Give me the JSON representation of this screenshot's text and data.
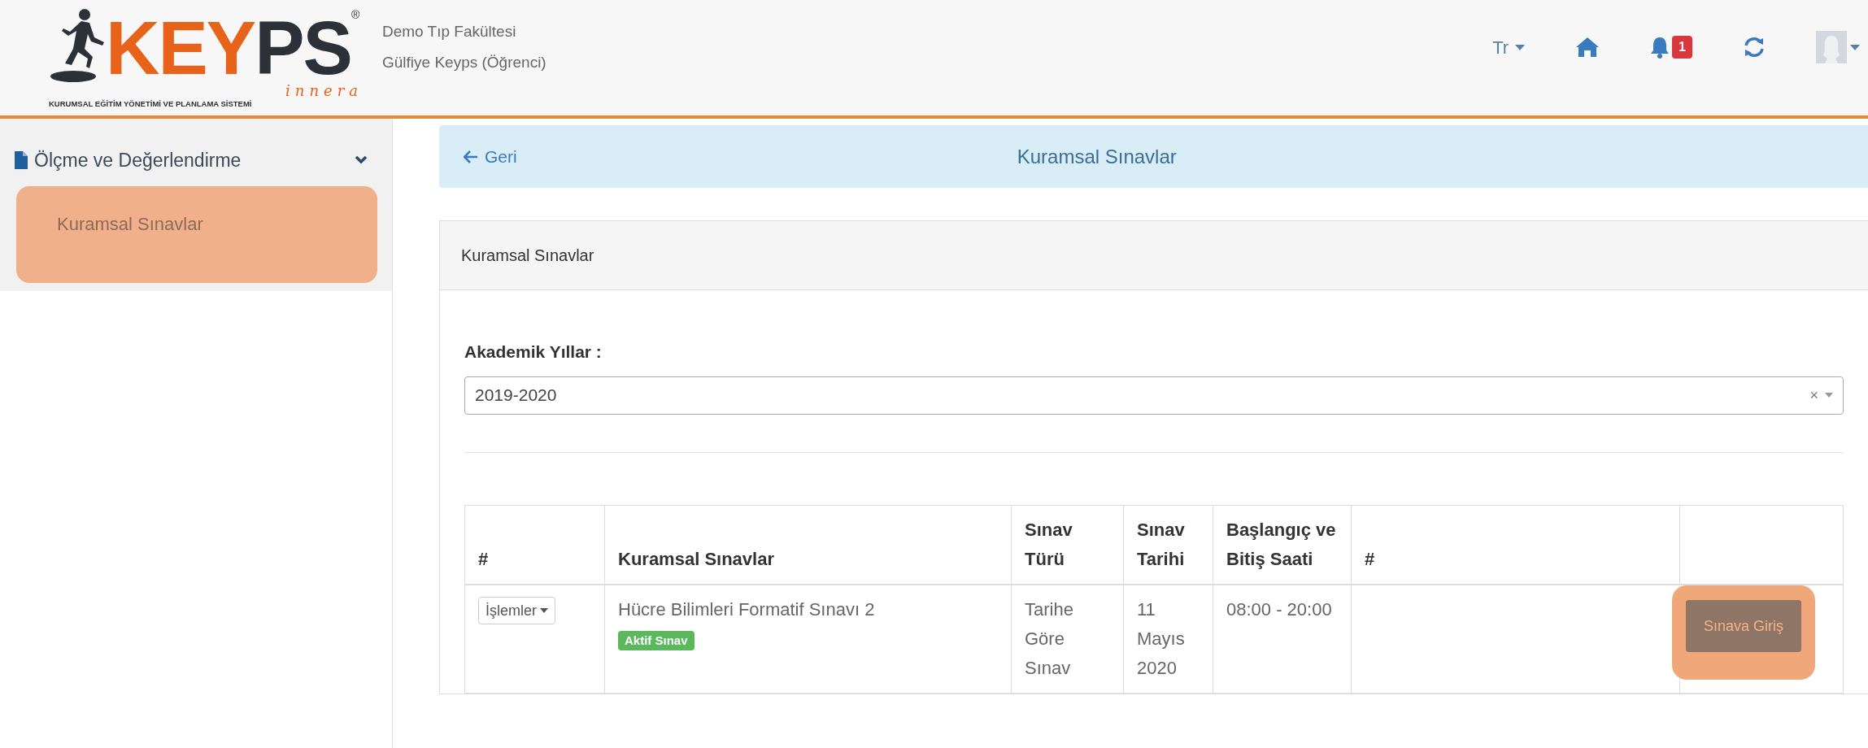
{
  "logo": {
    "brand_first": "KEY",
    "brand_second": "PS",
    "registered": "®",
    "sub": "innera",
    "tagline": "KURUMSAL EĞİTİM YÖNETİMİ VE PLANLAMA SİSTEMİ"
  },
  "header": {
    "institution": "Demo Tıp Fakültesi",
    "user": "Gülfiye Keyps (Öğrenci)",
    "language": "Tr",
    "notification_count": "1"
  },
  "sidebar": {
    "section": {
      "label": "Ölçme ve Değerlendirme",
      "expanded": true
    },
    "items": [
      {
        "label": "Kuramsal Sınavlar",
        "selected": true
      }
    ]
  },
  "page_bar": {
    "back": "Geri",
    "title": "Kuramsal Sınavlar"
  },
  "panel": {
    "heading": "Kuramsal Sınavlar",
    "filter_label": "Akademik Yıllar :",
    "filter_value": "2019-2020",
    "clear": "×"
  },
  "table": {
    "columns": [
      "#",
      "Kuramsal Sınavlar",
      "Sınav Türü",
      "Sınav Tarihi",
      "Başlangıç ve Bitiş Saati",
      "#"
    ],
    "rows": [
      {
        "actions": "İşlemler",
        "name": "Hücre Bilimleri Formatif Sınavı 2",
        "status": "Aktif Sınav",
        "type": "Tarihe Göre Sınav",
        "date": "11 Mayıs 2020",
        "time": "08:00 - 20:00",
        "button": "Sınava Giriş",
        "highlighted": true
      }
    ]
  }
}
